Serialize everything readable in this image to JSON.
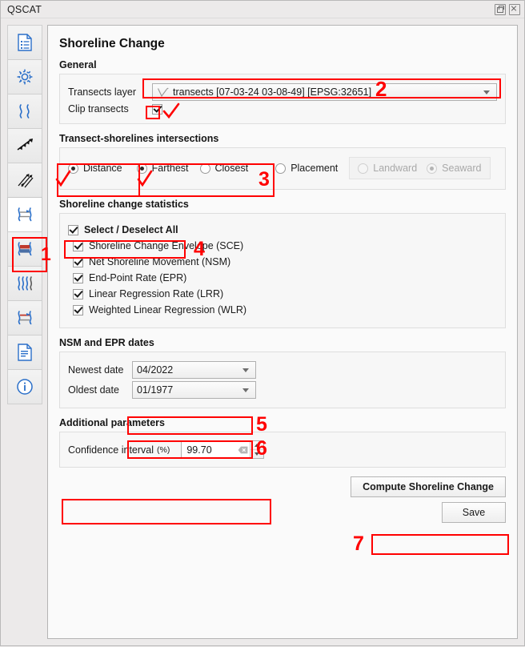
{
  "window": {
    "title": "QSCAT",
    "buttons": [
      {
        "name": "float-window-button",
        "label": "Undock"
      },
      {
        "name": "close-window-button",
        "label": "Close"
      }
    ]
  },
  "sidebar": {
    "items": [
      {
        "id": "summary-report",
        "icon": "document-list-icon",
        "active": false
      },
      {
        "id": "automator-settings",
        "icon": "gear-icon",
        "active": false
      },
      {
        "id": "shorelines",
        "icon": "shorelines-icon",
        "active": false
      },
      {
        "id": "baseline",
        "icon": "baseline-arrows-icon",
        "active": false
      },
      {
        "id": "transects",
        "icon": "transects-arrows-icon",
        "active": false
      },
      {
        "id": "shoreline-change",
        "icon": "shoreline-change-icon",
        "active": true
      },
      {
        "id": "area-change",
        "icon": "area-change-icon",
        "active": false
      },
      {
        "id": "forecasting",
        "icon": "forecasting-waves-icon",
        "active": false
      },
      {
        "id": "visualization",
        "icon": "visualization-icon",
        "active": false
      },
      {
        "id": "report",
        "icon": "report-document-icon",
        "active": false
      },
      {
        "id": "about",
        "icon": "info-icon",
        "active": false
      }
    ]
  },
  "main": {
    "page_title": "Shoreline Change",
    "general": {
      "legend": "General",
      "transects_layer_label": "Transects layer",
      "transects_layer_value": "transects [07-03-24 03-08-49] [EPSG:32651]",
      "clip_transects_label": "Clip transects",
      "clip_transects_checked": true
    },
    "intersections": {
      "legend": "Transect-shorelines intersections",
      "distance_label": "Distance",
      "distance_selected": true,
      "farthest_label": "Farthest",
      "farthest_selected": true,
      "closest_label": "Closest",
      "closest_selected": false,
      "placement_label": "Placement",
      "placement_selected": false,
      "landward_label": "Landward",
      "landward_selected": false,
      "seaward_label": "Seaward",
      "seaward_selected": true,
      "placement_group_disabled": true
    },
    "statistics": {
      "legend": "Shoreline change statistics",
      "select_all_label": "Select / Deselect All",
      "select_all_checked": true,
      "items": [
        {
          "label": "Shoreline Change Envelope (SCE)",
          "checked": true
        },
        {
          "label": "Net Shoreline Movement (NSM)",
          "checked": true
        },
        {
          "label": "End-Point Rate (EPR)",
          "checked": true
        },
        {
          "label": "Linear Regression Rate (LRR)",
          "checked": true
        },
        {
          "label": "Weighted Linear Regression (WLR)",
          "checked": true
        }
      ]
    },
    "dates": {
      "legend": "NSM and EPR dates",
      "newest_label": "Newest date",
      "newest_value": "04/2022",
      "oldest_label": "Oldest date",
      "oldest_value": "01/1977"
    },
    "additional": {
      "legend": "Additional parameters",
      "confidence_label": "Confidence interval",
      "confidence_unit": "(%)",
      "confidence_value": "99.70"
    },
    "actions": {
      "compute_label": "Compute Shoreline Change",
      "save_label": "Save"
    }
  },
  "annotations": {
    "accent_color": "#ff0000",
    "numbers": [
      "1",
      "2",
      "3",
      "4",
      "5",
      "6",
      "7"
    ]
  }
}
